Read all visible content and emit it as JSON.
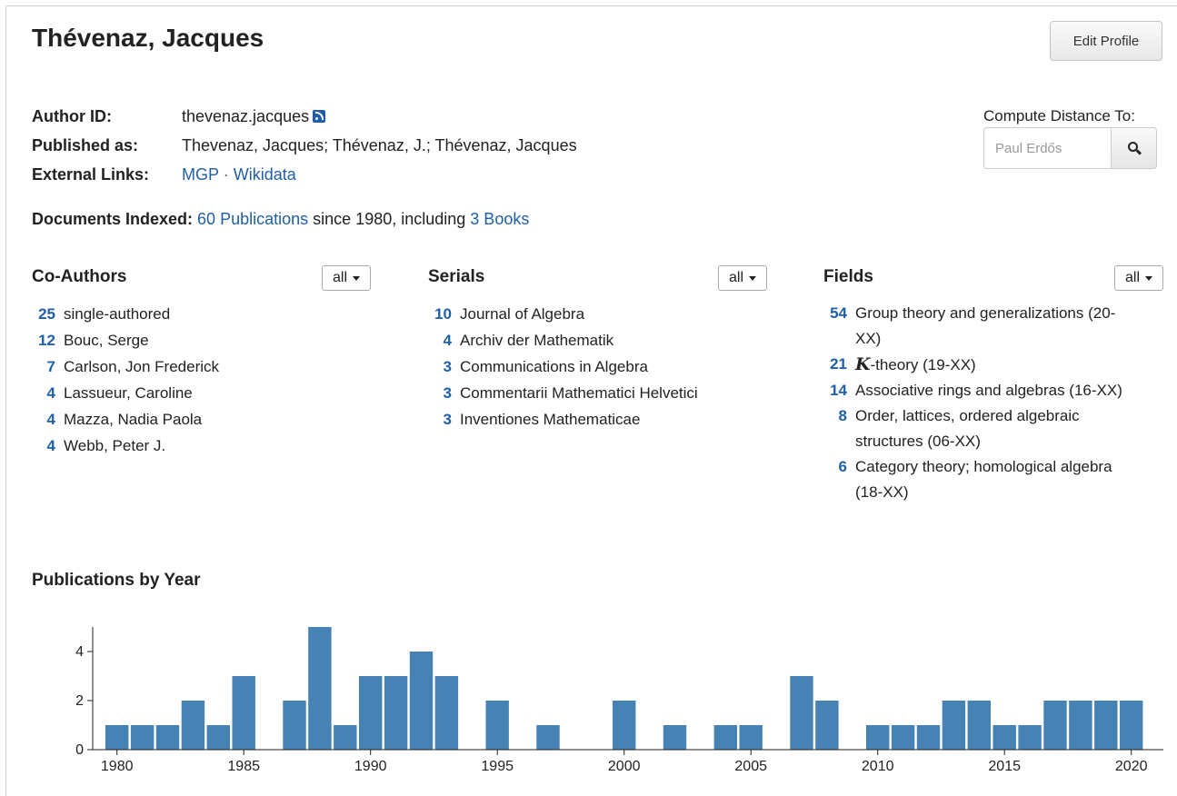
{
  "header": {
    "title": "Thévenaz, Jacques",
    "edit_button": "Edit Profile"
  },
  "author": {
    "id_label": "Author ID:",
    "id_value": "thevenaz.jacques",
    "rss_icon": "rss-icon",
    "published_label": "Published as:",
    "published_value": "Thevenaz, Jacques; Thévenaz, J.; Thévenaz, Jacques",
    "links_label": "External Links:",
    "links": [
      "MGP",
      "Wikidata"
    ],
    "links_sep": "·"
  },
  "distance": {
    "label": "Compute Distance To:",
    "placeholder": "Paul Erdős",
    "search_icon": "search-icon"
  },
  "documents": {
    "label": "Documents Indexed:",
    "publications_link": "60 Publications",
    "mid_text": "since 1980, including",
    "books_link": "3 Books"
  },
  "coauthors": {
    "heading": "Co-Authors",
    "filter": "all",
    "items": [
      {
        "count": "25",
        "name": "single-authored"
      },
      {
        "count": "12",
        "name": "Bouc, Serge"
      },
      {
        "count": "7",
        "name": "Carlson, Jon Frederick"
      },
      {
        "count": "4",
        "name": "Lassueur, Caroline"
      },
      {
        "count": "4",
        "name": "Mazza, Nadia Paola"
      },
      {
        "count": "4",
        "name": "Webb, Peter J."
      }
    ]
  },
  "serials": {
    "heading": "Serials",
    "filter": "all",
    "items": [
      {
        "count": "10",
        "name": "Journal of Algebra"
      },
      {
        "count": "4",
        "name": "Archiv der Mathematik"
      },
      {
        "count": "3",
        "name": "Communications in Algebra"
      },
      {
        "count": "3",
        "name": "Commentarii Mathematici Helvetici"
      },
      {
        "count": "3",
        "name": "Inventiones Mathematicae"
      }
    ]
  },
  "fields": {
    "heading": "Fields",
    "filter": "all",
    "items": [
      {
        "count": "54",
        "name": "Group theory and generalizations (20-XX)"
      },
      {
        "count": "21",
        "symbol": "K",
        "name": "-theory (19-XX)"
      },
      {
        "count": "14",
        "name": "Associative rings and algebras (16-XX)"
      },
      {
        "count": "8",
        "name": "Order, lattices, ordered algebraic structures (06-XX)"
      },
      {
        "count": "6",
        "name": "Category theory; homological algebra (18-XX)"
      }
    ]
  },
  "chart_section": {
    "heading": "Publications by Year"
  },
  "colors": {
    "bar": "#4682b4",
    "link": "#1f5fa8"
  },
  "chart_data": {
    "type": "bar",
    "title": "Publications by Year",
    "xlabel": "",
    "ylabel": "",
    "categories": [
      1980,
      1981,
      1982,
      1983,
      1984,
      1985,
      1986,
      1987,
      1988,
      1989,
      1990,
      1991,
      1992,
      1993,
      1994,
      1995,
      1996,
      1997,
      1998,
      1999,
      2000,
      2001,
      2002,
      2003,
      2004,
      2005,
      2006,
      2007,
      2008,
      2009,
      2010,
      2011,
      2012,
      2013,
      2014,
      2015,
      2016,
      2017,
      2018,
      2019,
      2020
    ],
    "values": [
      1,
      1,
      1,
      2,
      1,
      3,
      0,
      2,
      5,
      1,
      3,
      3,
      4,
      3,
      0,
      2,
      0,
      1,
      0,
      0,
      2,
      0,
      1,
      0,
      1,
      1,
      0,
      3,
      2,
      0,
      1,
      1,
      1,
      2,
      2,
      1,
      1,
      2,
      2,
      2,
      2
    ],
    "xticks": [
      1980,
      1985,
      1990,
      1995,
      2000,
      2005,
      2010,
      2015,
      2020
    ],
    "yticks": [
      0,
      2,
      4
    ],
    "ylim": [
      0,
      5
    ],
    "grid": false
  }
}
